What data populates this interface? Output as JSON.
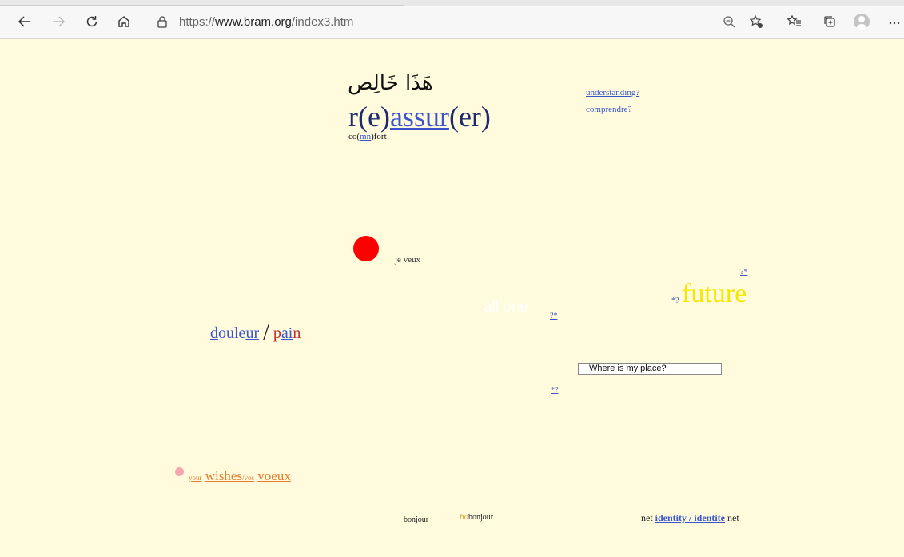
{
  "browser": {
    "url_prefix": "https://",
    "url_domain": "www.bram.org",
    "url_path": "/index3.htm",
    "icons": [
      "back-icon",
      "forward-icon",
      "refresh-icon",
      "home-icon",
      "lock-icon",
      "zoom-out-icon",
      "add-favorite-icon",
      "favorites-icon",
      "collections-icon",
      "profile-icon",
      "more-icon"
    ]
  },
  "page": {
    "arabic_text": "هَذَا خَالِص",
    "reassur": {
      "pre": "r(e)",
      "link": "assur",
      "post": "(er)"
    },
    "comfort": {
      "pre": "co(",
      "link": "mn",
      "post": ")fort"
    },
    "understanding_link": "understanding?",
    "comprendre_link": "comprendre?",
    "je_veux": "je veux",
    "all_one": "all one",
    "q_link_1": "?*",
    "q_link_2": "?*",
    "star_q_future": "*?",
    "star_q_bottom": "*?",
    "future": "future",
    "douleur": {
      "d": "d",
      "oule": "oule",
      "ur": "ur",
      "slash": "/",
      "p": "p",
      "ai": "ai",
      "n": "n"
    },
    "place_input_value": "Where is my place?",
    "wishes": {
      "your": "your",
      "wishes": "wishes",
      "vos": "/vos",
      "voeux": "voeux"
    },
    "bonjour_1": "bonjour",
    "bo": "bo",
    "bonjour_2": "bonjour",
    "identity": {
      "pre": "net",
      "link": "identity / identité",
      "post": "net"
    }
  },
  "colors": {
    "background": "#fffbdc",
    "red_ball": "#ff0000",
    "future": "#f5e800",
    "link": "#3a55cc",
    "wishes": "#e87c2e"
  }
}
